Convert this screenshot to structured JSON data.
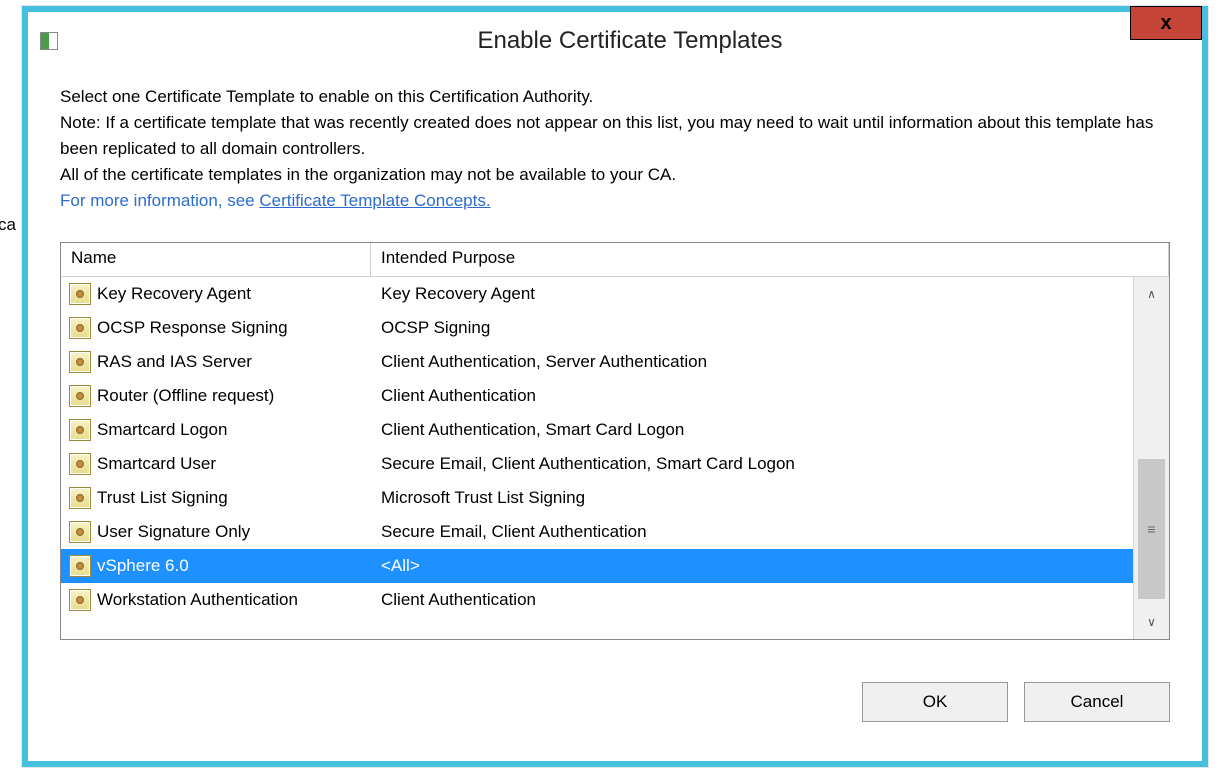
{
  "stray": "ca",
  "window": {
    "title": "Enable Certificate Templates",
    "close": "x"
  },
  "instructions": {
    "line1": "Select one Certificate Template to enable on this Certification Authority.",
    "line2": "Note: If a certificate template that was recently created does not appear on this list, you may need to wait until information about this template has been replicated to all domain controllers.",
    "line3": "All of the certificate templates in the organization may not be available to your CA.",
    "moreinfo_prefix": "For more information, see ",
    "moreinfo_link": "Certificate Template Concepts."
  },
  "list": {
    "headers": {
      "name": "Name",
      "purpose": "Intended Purpose"
    },
    "rows": [
      {
        "name": "Key Recovery Agent",
        "purpose": "Key Recovery Agent",
        "selected": false
      },
      {
        "name": "OCSP Response Signing",
        "purpose": "OCSP Signing",
        "selected": false
      },
      {
        "name": "RAS and IAS Server",
        "purpose": "Client Authentication, Server Authentication",
        "selected": false
      },
      {
        "name": "Router (Offline request)",
        "purpose": "Client Authentication",
        "selected": false
      },
      {
        "name": "Smartcard Logon",
        "purpose": "Client Authentication, Smart Card Logon",
        "selected": false
      },
      {
        "name": "Smartcard User",
        "purpose": "Secure Email, Client Authentication, Smart Card Logon",
        "selected": false
      },
      {
        "name": "Trust List Signing",
        "purpose": "Microsoft Trust List Signing",
        "selected": false
      },
      {
        "name": "User Signature Only",
        "purpose": "Secure Email, Client Authentication",
        "selected": false
      },
      {
        "name": "vSphere 6.0",
        "purpose": "<All>",
        "selected": true
      },
      {
        "name": "Workstation Authentication",
        "purpose": "Client Authentication",
        "selected": false
      }
    ],
    "scrollbar": {
      "up": "∧",
      "down": "∨",
      "grip": "≡"
    }
  },
  "buttons": {
    "ok": "OK",
    "cancel": "Cancel"
  }
}
